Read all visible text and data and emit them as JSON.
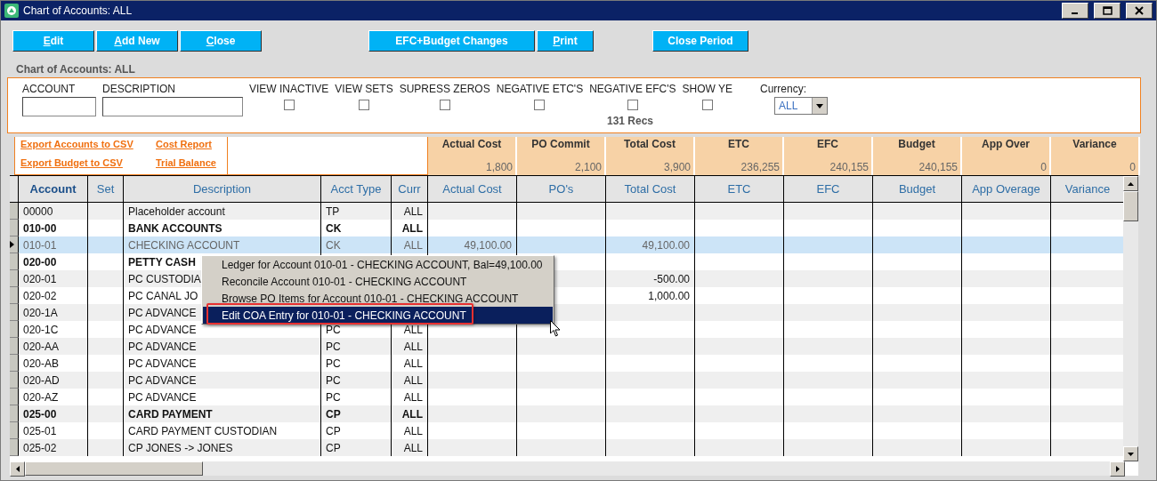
{
  "window": {
    "title": "Chart of Accounts: ALL"
  },
  "toolbar": [
    {
      "label": "Edit",
      "access_key": true
    },
    {
      "label": "Add New",
      "access_key": true
    },
    {
      "label": "Close",
      "access_key": true
    },
    {
      "label": "EFC+Budget Changes",
      "access_key": false
    },
    {
      "label": "Print",
      "access_key": true
    },
    {
      "label": "Close Period",
      "access_key": false
    }
  ],
  "subtitle": "Chart of Accounts: ALL",
  "filters": {
    "account": {
      "label": "ACCOUNT"
    },
    "description": {
      "label": "DESCRIPTION"
    },
    "checkboxes": [
      {
        "label": "VIEW INACTIVE",
        "checked": false
      },
      {
        "label": "VIEW SETS",
        "checked": false
      },
      {
        "label": "SUPRESS ZEROS",
        "checked": false
      },
      {
        "label": "NEGATIVE ETC'S",
        "checked": false
      },
      {
        "label": "NEGATIVE EFC'S",
        "checked": false
      },
      {
        "label": "SHOW YE",
        "checked": false
      }
    ],
    "currency": {
      "label": "Currency:",
      "value": "ALL"
    },
    "records": "131 Recs"
  },
  "links": [
    [
      "Export Accounts to CSV",
      "Cost Report"
    ],
    [
      "Export Budget to CSV",
      "Trial Balance"
    ]
  ],
  "summary": [
    {
      "label": "Actual Cost",
      "value": "1,800"
    },
    {
      "label": "PO Commit",
      "value": "2,100"
    },
    {
      "label": "Total Cost",
      "value": "3,900"
    },
    {
      "label": "ETC",
      "value": "236,255"
    },
    {
      "label": "EFC",
      "value": "240,155"
    },
    {
      "label": "Budget",
      "value": "240,155"
    },
    {
      "label": "App Over",
      "value": "0"
    },
    {
      "label": "Variance",
      "value": "0"
    }
  ],
  "grid": {
    "columns": [
      {
        "label": "Account",
        "sorted": true
      },
      {
        "label": "Set",
        "sorted": false
      },
      {
        "label": "Description",
        "sorted": false
      },
      {
        "label": "Acct Type",
        "sorted": false
      },
      {
        "label": "Curr",
        "sorted": false
      },
      {
        "label": "Actual Cost",
        "sorted": false
      },
      {
        "label": "PO's",
        "sorted": false
      },
      {
        "label": "Total Cost",
        "sorted": false
      },
      {
        "label": "ETC",
        "sorted": false
      },
      {
        "label": "EFC",
        "sorted": false
      },
      {
        "label": "Budget",
        "sorted": false
      },
      {
        "label": "App Overage",
        "sorted": false
      },
      {
        "label": "Variance",
        "sorted": false
      }
    ],
    "rows": [
      {
        "account": "00000",
        "description": "Placeholder account",
        "acct_type": "TP",
        "curr": "ALL",
        "actual_cost": "",
        "total_cost": "",
        "bold": false,
        "selected": false
      },
      {
        "account": "010-00",
        "description": "BANK ACCOUNTS",
        "acct_type": "CK",
        "curr": "ALL",
        "actual_cost": "",
        "total_cost": "",
        "bold": true,
        "selected": false
      },
      {
        "account": "010-01",
        "description": "CHECKING ACCOUNT",
        "acct_type": "CK",
        "curr": "ALL",
        "actual_cost": "49,100.00",
        "total_cost": "49,100.00",
        "bold": false,
        "selected": true
      },
      {
        "account": "020-00",
        "description": "PETTY CASH",
        "acct_type": "",
        "curr": "",
        "actual_cost": "",
        "total_cost": "",
        "bold": true,
        "selected": false
      },
      {
        "account": "020-01",
        "description": "PC CUSTODIA",
        "acct_type": "",
        "curr": "",
        "actual_cost": "",
        "total_cost": "-500.00",
        "bold": false,
        "selected": false
      },
      {
        "account": "020-02",
        "description": "PC CANAL JO",
        "acct_type": "",
        "curr": "",
        "actual_cost": "",
        "total_cost": "1,000.00",
        "bold": false,
        "selected": false
      },
      {
        "account": "020-1A",
        "description": "PC ADVANCE",
        "acct_type": "",
        "curr": "",
        "actual_cost": "",
        "total_cost": "",
        "bold": false,
        "selected": false
      },
      {
        "account": "020-1C",
        "description": "PC ADVANCE",
        "acct_type": "PC",
        "curr": "ALL",
        "actual_cost": "",
        "total_cost": "",
        "bold": false,
        "selected": false
      },
      {
        "account": "020-AA",
        "description": "PC ADVANCE",
        "acct_type": "PC",
        "curr": "ALL",
        "actual_cost": "",
        "total_cost": "",
        "bold": false,
        "selected": false
      },
      {
        "account": "020-AB",
        "description": "PC ADVANCE",
        "acct_type": "PC",
        "curr": "ALL",
        "actual_cost": "",
        "total_cost": "",
        "bold": false,
        "selected": false
      },
      {
        "account": "020-AD",
        "description": "PC ADVANCE",
        "acct_type": "PC",
        "curr": "ALL",
        "actual_cost": "",
        "total_cost": "",
        "bold": false,
        "selected": false
      },
      {
        "account": "020-AZ",
        "description": "PC ADVANCE",
        "acct_type": "PC",
        "curr": "ALL",
        "actual_cost": "",
        "total_cost": "",
        "bold": false,
        "selected": false
      },
      {
        "account": "025-00",
        "description": "CARD PAYMENT",
        "acct_type": "CP",
        "curr": "ALL",
        "actual_cost": "",
        "total_cost": "",
        "bold": true,
        "selected": false
      },
      {
        "account": "025-01",
        "description": "CARD PAYMENT CUSTODIAN",
        "acct_type": "CP",
        "curr": "ALL",
        "actual_cost": "",
        "total_cost": "",
        "bold": false,
        "selected": false
      },
      {
        "account": "025-02",
        "description": "CP JONES -> JONES",
        "acct_type": "CP",
        "curr": "ALL",
        "actual_cost": "",
        "total_cost": "",
        "bold": false,
        "selected": false
      }
    ]
  },
  "context_menu": [
    {
      "label": "Ledger for Account 010-01 - CHECKING ACCOUNT,  Bal=49,100.00",
      "selected": false
    },
    {
      "label": "Reconcile Account 010-01 - CHECKING ACCOUNT",
      "selected": false
    },
    {
      "label": "Browse PO Items for Account 010-01 - CHECKING ACCOUNT",
      "selected": false
    },
    {
      "label": "Edit COA Entry for 010-01 - CHECKING ACCOUNT",
      "selected": true
    }
  ]
}
